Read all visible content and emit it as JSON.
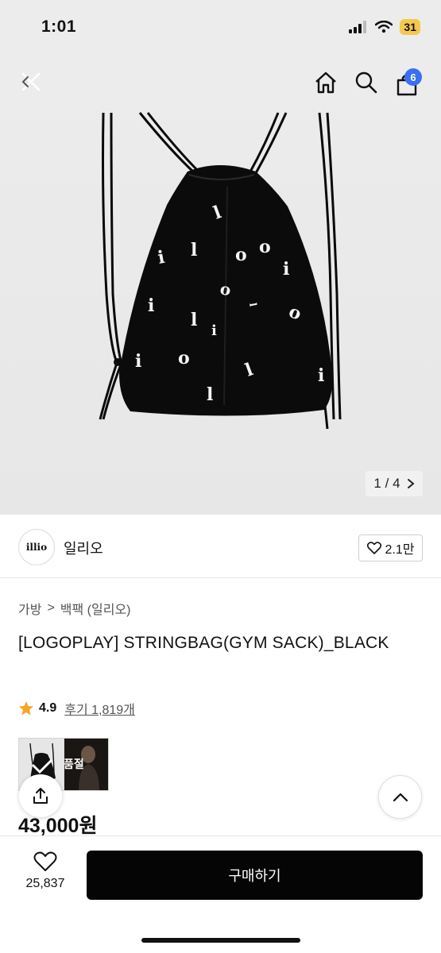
{
  "status_bar": {
    "time": "1:01",
    "battery": "31"
  },
  "header": {
    "cart_badge": "6"
  },
  "gallery": {
    "current": "1",
    "separator": "/",
    "total": "4",
    "bag_letters": [
      "l",
      "o",
      "i",
      "l",
      "o",
      "i",
      "o",
      "i",
      "l",
      "i",
      "o",
      "l",
      "i",
      "o",
      "l",
      "i",
      "l"
    ]
  },
  "brand": {
    "logo_text": "illio",
    "name": "일리오",
    "likes": "2.1만"
  },
  "breadcrumb": {
    "category": "가방",
    "separator": ">",
    "subcategory": "백팩 (일리오)"
  },
  "product": {
    "title": "[LOGOPLAY] STRINGBAG(GYM SACK)_BLACK",
    "rating": "4.9",
    "reviews": "후기 1,819개",
    "soldout_label": "품절",
    "price": "43,000원"
  },
  "bottom_bar": {
    "wish_count": "25,837",
    "buy_label": "구매하기"
  },
  "colors": {
    "accent_badge": "#3a6ff2",
    "star": "#f5a623",
    "buy_button": "#050505"
  }
}
